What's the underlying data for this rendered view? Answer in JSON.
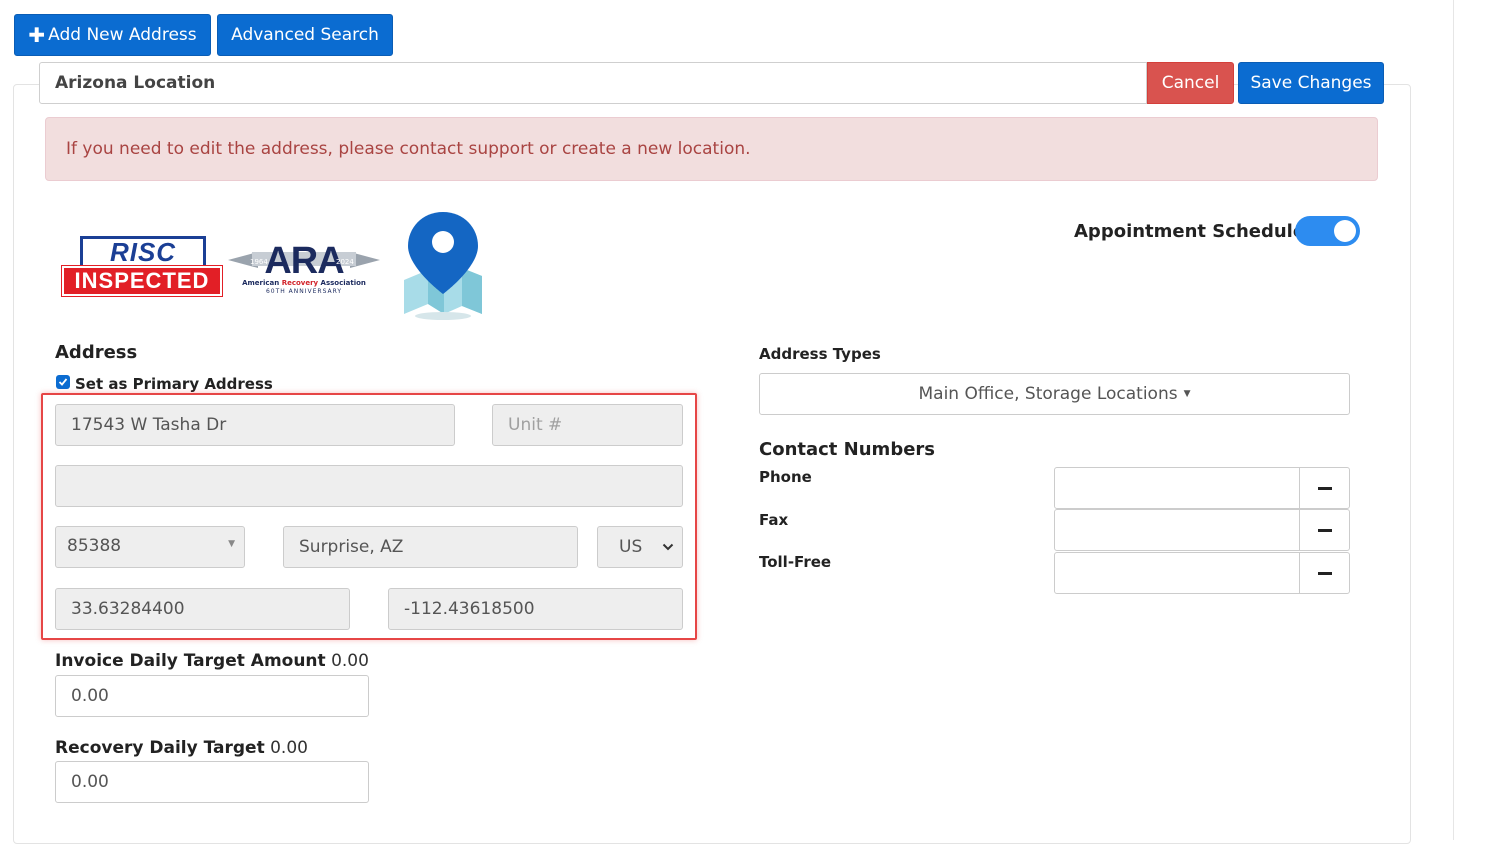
{
  "toolbar": {
    "add_label": "Add New Address",
    "add_icon": "plus-icon",
    "advanced_label": "Advanced Search"
  },
  "location": {
    "name": "Arizona Location",
    "cancel_label": "Cancel",
    "save_label": "Save Changes"
  },
  "alert": {
    "message": "If you need to edit the address, please contact support or create a new location."
  },
  "badges": {
    "risc_top": "RISC",
    "risc_bottom": "INSPECTED",
    "ara_letters": "ARA",
    "ara_year_left": "1964",
    "ara_year_right": "2024",
    "ara_name_prefix": "American ",
    "ara_name_highlight": "Recovery",
    "ara_name_suffix": " Association",
    "ara_anniversary": "60TH ANNIVERSARY"
  },
  "appointment": {
    "label": "Appointment Schedule",
    "enabled": true
  },
  "address": {
    "heading": "Address",
    "primary_label": "Set as Primary Address",
    "primary_checked": true,
    "street": "17543 W Tasha Dr",
    "unit_placeholder": "Unit #",
    "line2": "",
    "zip": "85388",
    "city": "Surprise, AZ",
    "country": "US",
    "latitude": "33.63284400",
    "longitude": "-112.43618500"
  },
  "targets": {
    "invoice_label": "Invoice Daily Target Amount",
    "invoice_value_text": "0.00",
    "invoice_input": "0.00",
    "recovery_label": "Recovery Daily Target",
    "recovery_value_text": "0.00",
    "recovery_input": "0.00"
  },
  "address_types": {
    "label": "Address Types",
    "selected": "Main Office, Storage Locations"
  },
  "contacts": {
    "heading": "Contact Numbers",
    "phone_label": "Phone",
    "fax_label": "Fax",
    "tollfree_label": "Toll-Free",
    "phone": "",
    "fax": "",
    "tollfree": ""
  },
  "colors": {
    "primary": "#0b6cd1",
    "danger": "#d9534f",
    "alert_bg": "#f2dede",
    "alert_text": "#a94442",
    "highlight": "#e64646"
  }
}
